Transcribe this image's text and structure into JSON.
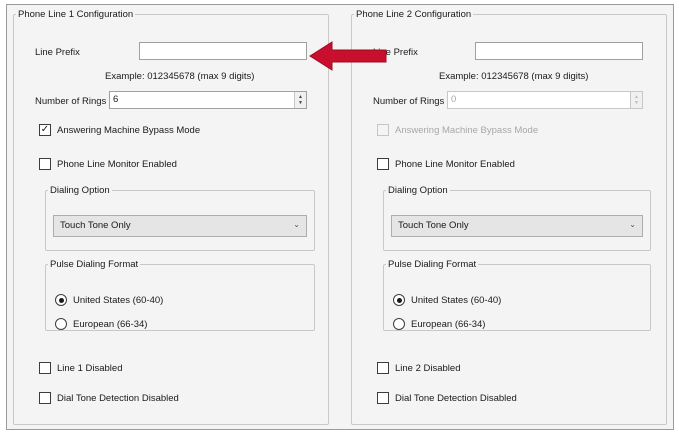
{
  "panels": [
    {
      "title": "Phone Line 1 Configuration",
      "line_prefix_label": "Line Prefix",
      "line_prefix_value": "",
      "example_text": "Example: 012345678 (max 9 digits)",
      "rings_label": "Number of Rings",
      "rings_value": "6",
      "answering_machine_label": "Answering Machine Bypass Mode",
      "answering_machine_checked": true,
      "answering_machine_disabled": false,
      "monitor_label": "Phone Line Monitor Enabled",
      "dialing_group_title": "Dialing Option",
      "dialing_selected": "Touch Tone Only",
      "pulse_group_title": "Pulse Dialing Format",
      "pulse_us_label": "United States (60-40)",
      "pulse_eu_label": "European (66-34)",
      "line_disabled_label": "Line 1 Disabled",
      "dial_tone_label": "Dial Tone Detection Disabled"
    },
    {
      "title": "Phone Line 2 Configuration",
      "line_prefix_label": "Line Prefix",
      "line_prefix_value": "",
      "example_text": "Example: 012345678 (max 9 digits)",
      "rings_label": "Number of Rings",
      "rings_value": "0",
      "answering_machine_label": "Answering Machine Bypass Mode",
      "answering_machine_checked": false,
      "answering_machine_disabled": true,
      "monitor_label": "Phone Line Monitor Enabled",
      "dialing_group_title": "Dialing Option",
      "dialing_selected": "Touch Tone Only",
      "pulse_group_title": "Pulse Dialing Format",
      "pulse_us_label": "United States (60-40)",
      "pulse_eu_label": "European (66-34)",
      "line_disabled_label": "Line 2 Disabled",
      "dial_tone_label": "Dial Tone Detection Disabled"
    }
  ],
  "icons": {
    "check": "✓",
    "spin_up": "▲",
    "spin_down": "▼",
    "chevron": "⌄"
  },
  "colors": {
    "annotation_arrow": "#c8102e"
  }
}
